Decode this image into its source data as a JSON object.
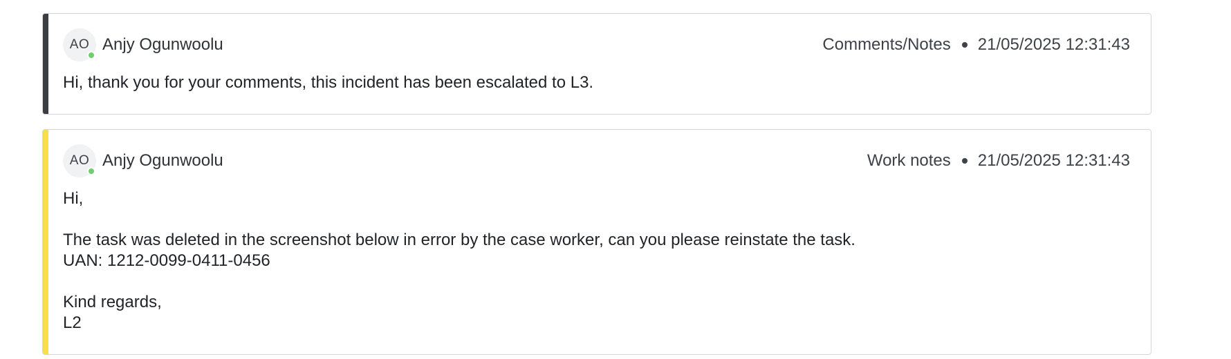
{
  "colors": {
    "comment_accent": "#3a3d42",
    "worknote_accent": "#f5df4d",
    "presence_online": "#6fcf6a"
  },
  "entries": [
    {
      "type": "comment",
      "author_initials": "AO",
      "author_name": "Anjy Ogunwoolu",
      "category": "Comments/Notes",
      "timestamp": "21/05/2025 12:31:43",
      "body_lines": [
        "Hi, thank you for your comments, this incident has been escalated to L3."
      ]
    },
    {
      "type": "worknote",
      "author_initials": "AO",
      "author_name": "Anjy Ogunwoolu",
      "category": "Work notes",
      "timestamp": "21/05/2025 12:31:43",
      "body_lines": [
        "Hi,",
        "",
        "The task was deleted in the screenshot below in error by the case worker, can you please reinstate the task.",
        "UAN: 1212-0099-0411-0456",
        "",
        "Kind regards,",
        "L2"
      ]
    }
  ]
}
